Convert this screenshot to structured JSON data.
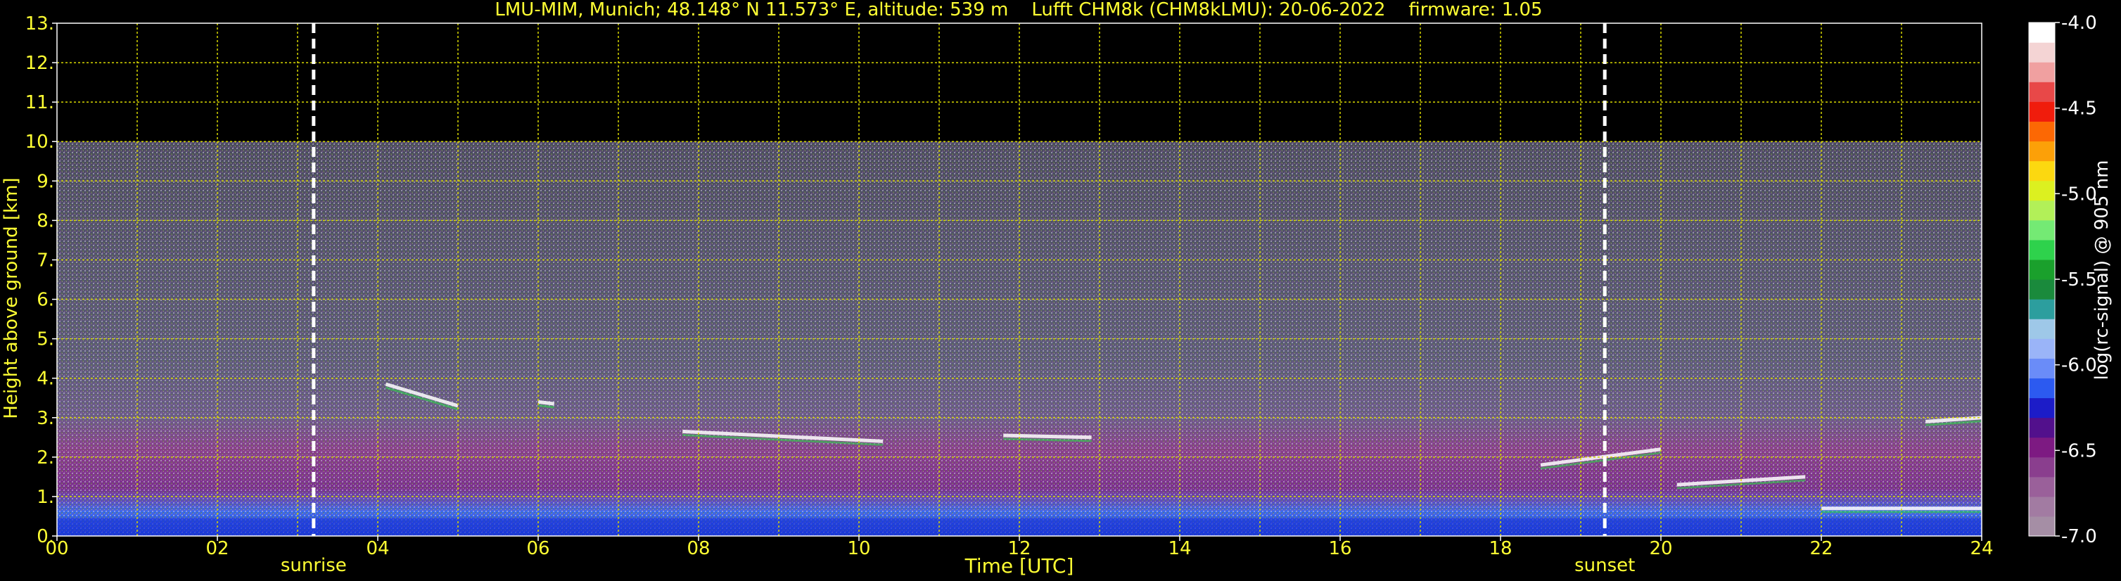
{
  "chart_data": {
    "type": "heatmap",
    "title": "LMU-MIM, Munich; 48.148° N 11.573° E, altitude: 539 m    Lufft CHM8k (CHM8kLMU): 20-06-2022    firmware: 1.05",
    "xlabel": "Time [UTC]",
    "ylabel": "Height above ground [km]",
    "xlim": [
      0,
      24
    ],
    "ylim": [
      0,
      13
    ],
    "x_ticks": [
      "00",
      "02",
      "04",
      "06",
      "08",
      "10",
      "12",
      "14",
      "16",
      "18",
      "20",
      "22",
      "24"
    ],
    "x_tick_values": [
      0,
      2,
      4,
      6,
      8,
      10,
      12,
      14,
      16,
      18,
      20,
      22,
      24
    ],
    "y_ticks": [
      "0.",
      "1.",
      "2.",
      "3.",
      "4.",
      "5.",
      "6.",
      "7.",
      "8.",
      "9.",
      "10.",
      "11.",
      "12.",
      "13."
    ],
    "y_tick_values": [
      0,
      1,
      2,
      3,
      4,
      5,
      6,
      7,
      8,
      9,
      10,
      11,
      12,
      13
    ],
    "grid": true,
    "grid_minor_x_step": 1,
    "data_top_km": 10,
    "markers": [
      {
        "label": "sunrise",
        "x": 3.2
      },
      {
        "label": "sunset",
        "x": 19.3
      }
    ],
    "colorbar": {
      "label": "log(rc-signal) @ 905 nm",
      "min": -7.0,
      "max": -4.0,
      "ticks": [
        "-4.0",
        "-4.5",
        "-5.0",
        "-5.5",
        "-6.0",
        "-6.5",
        "-7.0"
      ],
      "tick_values": [
        -4.0,
        -4.5,
        -5.0,
        -5.5,
        -6.0,
        -6.5,
        -7.0
      ],
      "colors": [
        "#a58ea5",
        "#a27ba2",
        "#9a609a",
        "#8a3e8e",
        "#7d1a82",
        "#52108c",
        "#1c1cc8",
        "#2c5af0",
        "#6a8cf8",
        "#9ab4f8",
        "#9ec8e8",
        "#2c9e9e",
        "#1a8a3c",
        "#1aa02c",
        "#2ed24c",
        "#74ea74",
        "#b2f058",
        "#dcf020",
        "#fcd810",
        "#fca008",
        "#fc6804",
        "#f01c0c",
        "#e84848",
        "#f0a0a0",
        "#f4d4d4",
        "#ffffff"
      ]
    },
    "cloud_layers": [
      {
        "x": [
          4.1,
          5.0
        ],
        "y": [
          3.85,
          3.3
        ]
      },
      {
        "x": [
          6.0,
          6.2
        ],
        "y": [
          3.4,
          3.35
        ]
      },
      {
        "x": [
          7.8,
          10.3
        ],
        "y": [
          2.65,
          2.4
        ]
      },
      {
        "x": [
          11.8,
          12.9
        ],
        "y": [
          2.55,
          2.5
        ]
      },
      {
        "x": [
          18.5,
          20.0
        ],
        "y": [
          1.8,
          2.2
        ]
      },
      {
        "x": [
          20.2,
          21.8
        ],
        "y": [
          1.3,
          1.5
        ]
      },
      {
        "x": [
          22.0,
          24.0
        ],
        "y": [
          0.7,
          0.7
        ]
      },
      {
        "x": [
          23.3,
          24.0
        ],
        "y": [
          2.9,
          3.0
        ]
      }
    ]
  }
}
